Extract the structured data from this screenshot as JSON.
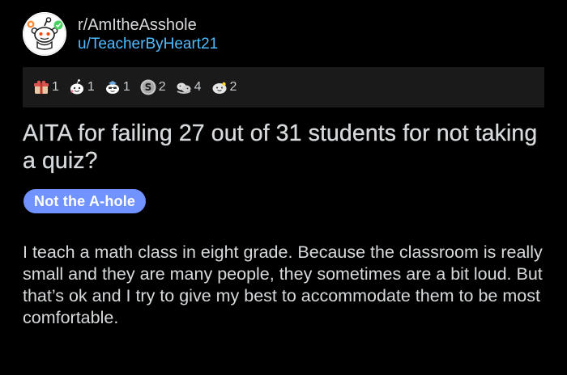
{
  "post": {
    "subreddit": "r/AmItheAsshole",
    "author": "u/TeacherByHeart21",
    "title": "AITA for failing 27 out of 31 students for not taking a quiz?",
    "flair": "Not the A-hole",
    "flair_color": "#7193ff",
    "body": "I teach a math class in eight grade. Because the classroom is really small and they are many people, they sometimes are a bit loud. But that’s ok and I try to give my best to accommodate them to be most comfortable."
  },
  "awards": [
    {
      "icon": "gift-award-icon",
      "count": "1"
    },
    {
      "icon": "wholesome-award-icon",
      "count": "1"
    },
    {
      "icon": "helpful-award-icon",
      "count": "1"
    },
    {
      "icon": "silver-award-icon",
      "count": "2"
    },
    {
      "icon": "hugz-award-icon",
      "count": "4"
    },
    {
      "icon": "wholesome-seal-award-icon",
      "count": "2"
    }
  ],
  "colors": {
    "background": "#000000",
    "text": "#d7dadc",
    "link": "#4fbcff",
    "awards_bar": "#1a1a1b"
  }
}
